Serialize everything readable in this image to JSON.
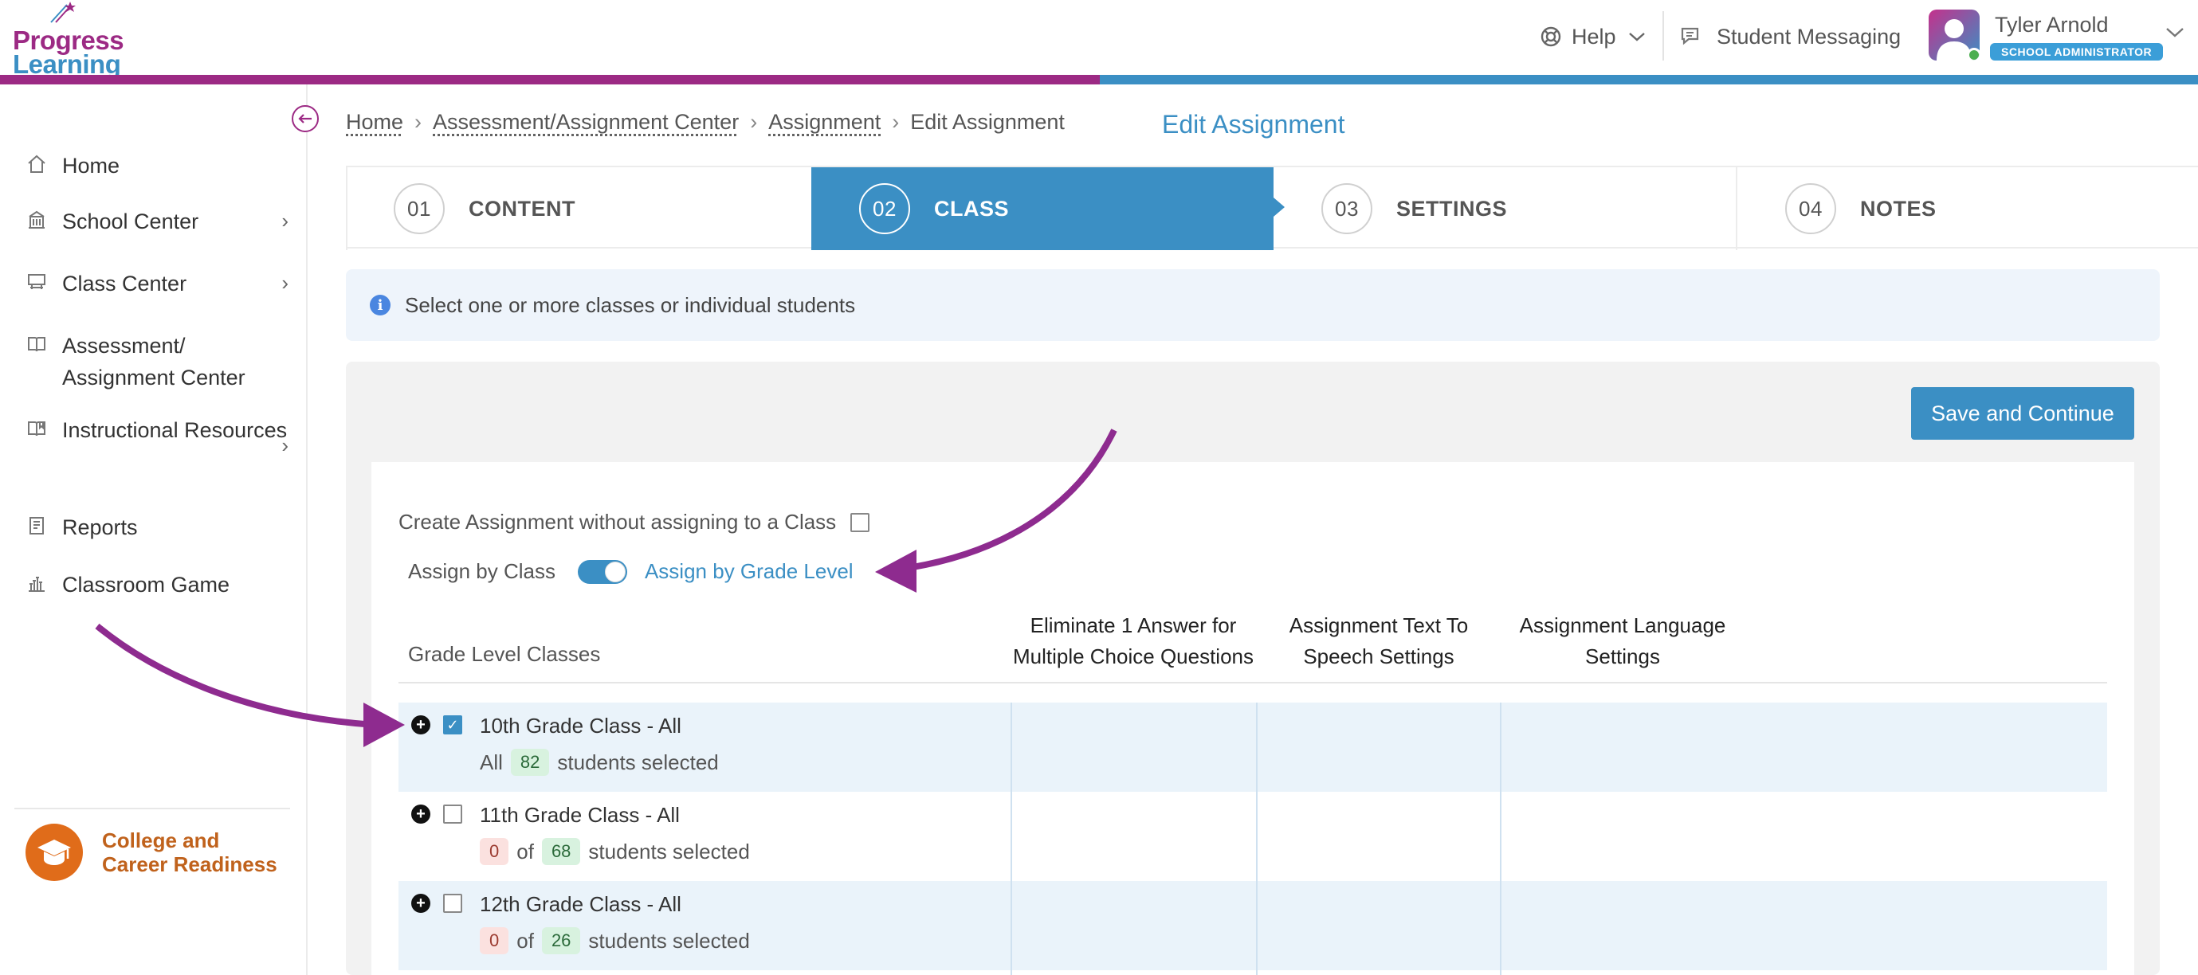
{
  "brand": {
    "logo_line1": "Progress",
    "logo_line2": "Learning",
    "purple": "#9c2a84",
    "blue": "#3b8fc4"
  },
  "header": {
    "help_label": "Help",
    "messaging_label": "Student Messaging",
    "user_name": "Tyler Arnold",
    "user_role": "SCHOOL ADMINISTRATOR"
  },
  "sidebar": {
    "items": [
      {
        "label": "Home",
        "icon": "home-icon",
        "has_chevron": false
      },
      {
        "label": "School Center",
        "icon": "building-icon",
        "has_chevron": true
      },
      {
        "label": "Class Center",
        "icon": "classroom-icon",
        "has_chevron": true
      },
      {
        "label": "Assessment/ Assignment Center",
        "icon": "book-icon",
        "has_chevron": false
      },
      {
        "label": "Instructional Resources",
        "icon": "open-book-icon",
        "has_chevron": true
      },
      {
        "label": "Reports",
        "icon": "report-icon",
        "has_chevron": false
      },
      {
        "label": "Classroom Game",
        "icon": "game-icon",
        "has_chevron": false
      }
    ],
    "footer_line1": "College and",
    "footer_line2": "Career Readiness"
  },
  "breadcrumb": {
    "items": [
      "Home",
      "Assessment/Assignment Center",
      "Assignment"
    ],
    "current": "Edit Assignment"
  },
  "page_title": "Edit Assignment",
  "steps": [
    {
      "num": "01",
      "label": "CONTENT",
      "active": false
    },
    {
      "num": "02",
      "label": "CLASS",
      "active": true
    },
    {
      "num": "03",
      "label": "SETTINGS",
      "active": false
    },
    {
      "num": "04",
      "label": "NOTES",
      "active": false
    }
  ],
  "info_text": "Select one or more classes or individual students",
  "save_button": "Save and Continue",
  "create_without_class_label": "Create Assignment without assigning to a Class",
  "assign_by_class_label": "Assign by Class",
  "assign_by_grade_label": "Assign by Grade Level",
  "table": {
    "grade_level_header": "Grade Level Classes",
    "col_eliminate_line1": "Eliminate 1 Answer for",
    "col_eliminate_line2": "Multiple Choice Questions",
    "col_tts_line1": "Assignment Text To",
    "col_tts_line2": "Speech Settings",
    "col_lang_line1": "Assignment Language",
    "col_lang_line2": "Settings",
    "rows": [
      {
        "name": "10th Grade Class - All",
        "checked": true,
        "prefix": "All",
        "selected": "",
        "of": "",
        "total": "82",
        "suffix": "students selected"
      },
      {
        "name": "11th Grade Class - All",
        "checked": false,
        "prefix": "",
        "selected": "0",
        "of": "of",
        "total": "68",
        "suffix": "students selected"
      },
      {
        "name": "12th Grade Class - All",
        "checked": false,
        "prefix": "",
        "selected": "0",
        "of": "of",
        "total": "26",
        "suffix": "students selected"
      }
    ]
  },
  "annotation_color": "#8e2b8f"
}
